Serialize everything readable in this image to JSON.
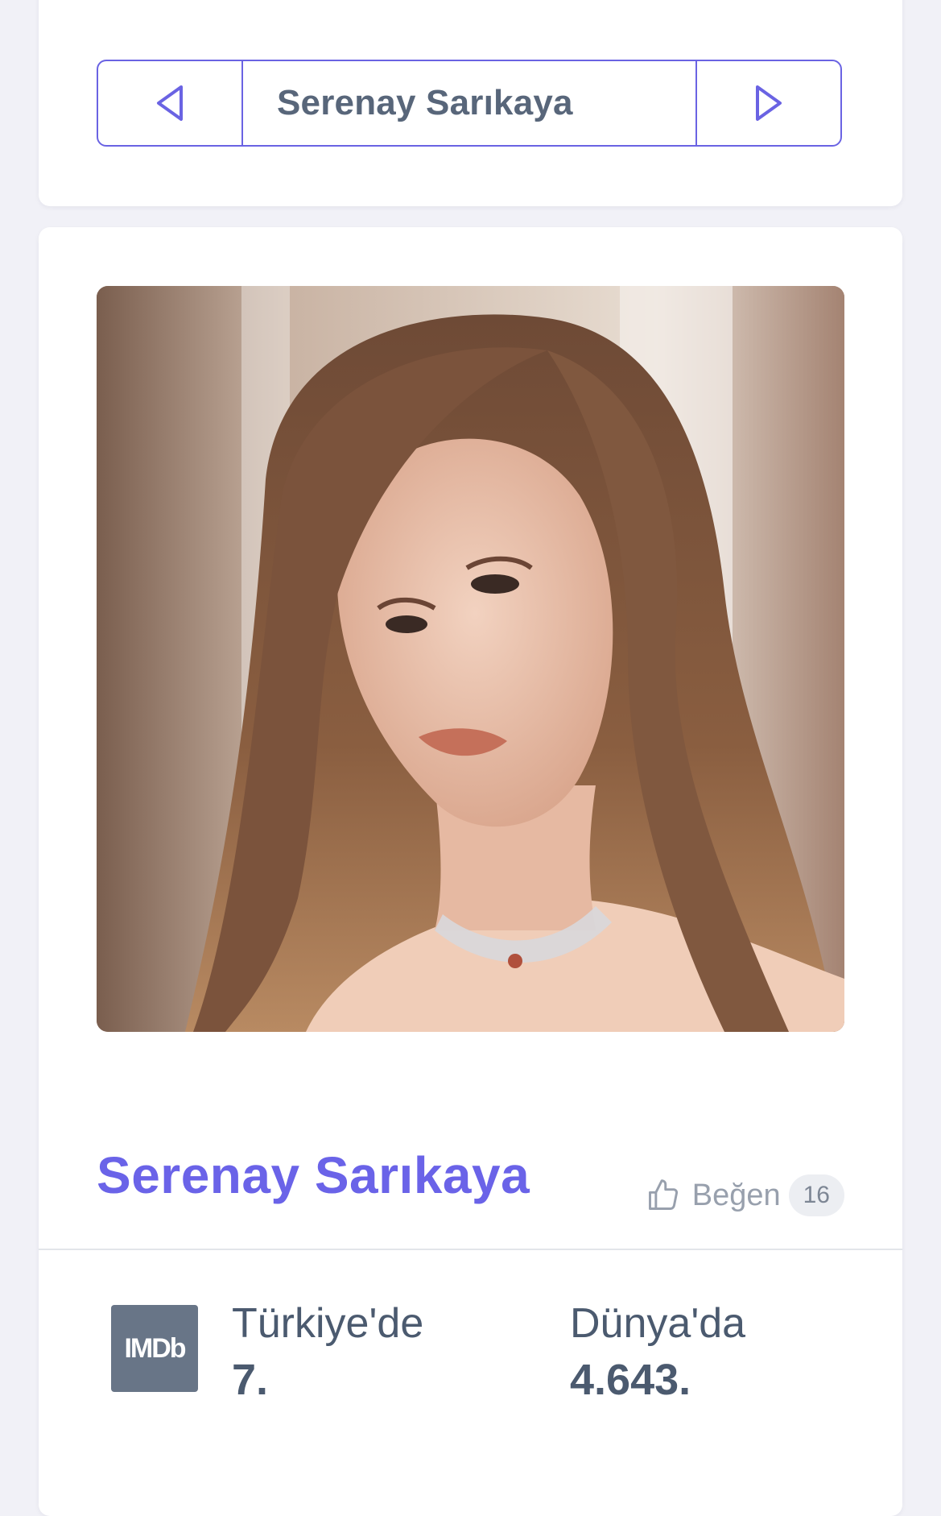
{
  "navigator": {
    "title": "Serenay Sarıkaya",
    "prev_icon": "triangle-left-icon",
    "next_icon": "triangle-right-icon"
  },
  "profile": {
    "name": "Serenay Sarıkaya",
    "like_label": "Beğen",
    "like_count": "16",
    "like_icon": "thumbs-up-icon"
  },
  "rankings": {
    "logo_text": "IMDb",
    "turkey_label": "Türkiye'de",
    "turkey_value": "7.",
    "world_label": "Dünya'da",
    "world_value": "4.643."
  },
  "colors": {
    "accent": "#6a63e8",
    "text": "#4b5a6f",
    "background": "#f1f1f7"
  }
}
